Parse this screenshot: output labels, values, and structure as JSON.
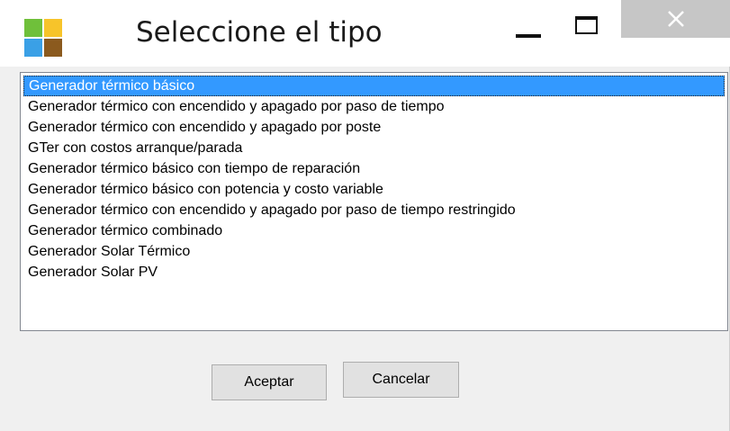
{
  "window": {
    "title": "Seleccione el tipo"
  },
  "icons": {
    "app": "app-tiles-icon",
    "minimize": "minimize-icon",
    "maximize": "maximize-icon",
    "close": "close-icon"
  },
  "colors": {
    "selection": "#3399ff",
    "close_button_bg": "#c6c6c6",
    "tile_green": "#6fc03a",
    "tile_yellow": "#f7c42a",
    "tile_blue": "#3aa0e6",
    "tile_brown": "#8b5a1e"
  },
  "list": {
    "selected_index": 0,
    "items": [
      "Generador térmico básico",
      "Generador térmico con encendido y apagado por paso de tiempo",
      "Generador térmico con encendido y apagado por poste",
      "GTer con costos arranque/parada",
      "Generador térmico básico con tiempo de reparación",
      "Generador térmico básico con potencia y costo variable",
      "Generador térmico con encendido y apagado por paso de tiempo restringido",
      "Generador térmico combinado",
      "Generador Solar Térmico",
      "Generador Solar PV"
    ]
  },
  "buttons": {
    "accept_label": "Aceptar",
    "cancel_label": "Cancelar"
  }
}
